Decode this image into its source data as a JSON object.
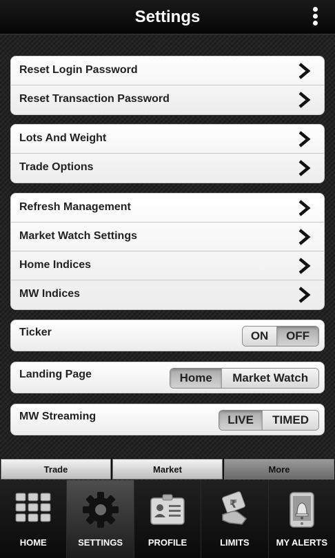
{
  "header": {
    "title": "Settings",
    "menu_icon": "kebab-menu-icon"
  },
  "groups": [
    {
      "items": [
        {
          "label": "Reset Login Password"
        },
        {
          "label": "Reset Transaction Password"
        }
      ]
    },
    {
      "items": [
        {
          "label": "Lots And Weight"
        },
        {
          "label": "Trade Options"
        }
      ]
    },
    {
      "items": [
        {
          "label": "Refresh Management"
        },
        {
          "label": "Market Watch Settings"
        },
        {
          "label": "Home Indices"
        },
        {
          "label": "MW Indices"
        }
      ]
    }
  ],
  "ticker": {
    "label": "Ticker",
    "options": [
      "ON",
      "OFF"
    ],
    "selected": "OFF"
  },
  "landing_page": {
    "label": "Landing Page",
    "options": [
      "Home",
      "Market Watch"
    ],
    "selected": "Home"
  },
  "mw_streaming": {
    "label": "MW Streaming",
    "options": [
      "LIVE",
      "TIMED"
    ],
    "selected": "LIVE"
  },
  "subtabs": {
    "items": [
      "Trade",
      "Market",
      "More"
    ],
    "active": "More"
  },
  "bottom_nav": {
    "items": [
      {
        "label": "HOME",
        "icon": "grid-icon"
      },
      {
        "label": "SETTINGS",
        "icon": "gear-icon"
      },
      {
        "label": "PROFILE",
        "icon": "id-card-icon"
      },
      {
        "label": "LIMITS",
        "icon": "rupee-hand-icon"
      },
      {
        "label": "MY ALERTS",
        "icon": "bell-phone-icon"
      }
    ],
    "active": "SETTINGS"
  },
  "colors": {
    "accent_dark": "#050505",
    "card_bg": "#ffffff",
    "selected_toggle": "#a9a9a9"
  }
}
